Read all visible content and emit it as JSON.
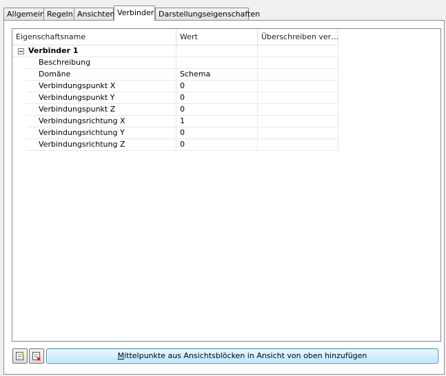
{
  "tabs": [
    {
      "label": "Allgemein",
      "active": false
    },
    {
      "label": "Regeln",
      "active": false
    },
    {
      "label": "Ansichten",
      "active": false
    },
    {
      "label": "Verbinder",
      "active": true
    },
    {
      "label": "Darstellungseigenschaften",
      "active": false
    }
  ],
  "grid": {
    "columns": [
      "Eigenschaftsname",
      "Wert",
      "Überschreiben ver…"
    ],
    "group": {
      "label": "Verbinder 1",
      "expanded": true
    },
    "rows": [
      {
        "name": "Beschreibung",
        "value": ""
      },
      {
        "name": "Domäne",
        "value": "Schema"
      },
      {
        "name": "Verbindungspunkt X",
        "value": "0"
      },
      {
        "name": "Verbindungspunkt Y",
        "value": "0"
      },
      {
        "name": "Verbindungspunkt Z",
        "value": "0"
      },
      {
        "name": "Verbindungsrichtung X",
        "value": "1"
      },
      {
        "name": "Verbindungsrichtung Y",
        "value": "0"
      },
      {
        "name": "Verbindungsrichtung Z",
        "value": "0"
      }
    ]
  },
  "buttons": {
    "add_icon": "add-connector-icon",
    "delete_icon": "delete-connector-icon",
    "main_hotkey": "M",
    "main_rest": "ittelpunkte aus Ansichtsblöcken in Ansicht von oben hinzufügen"
  }
}
